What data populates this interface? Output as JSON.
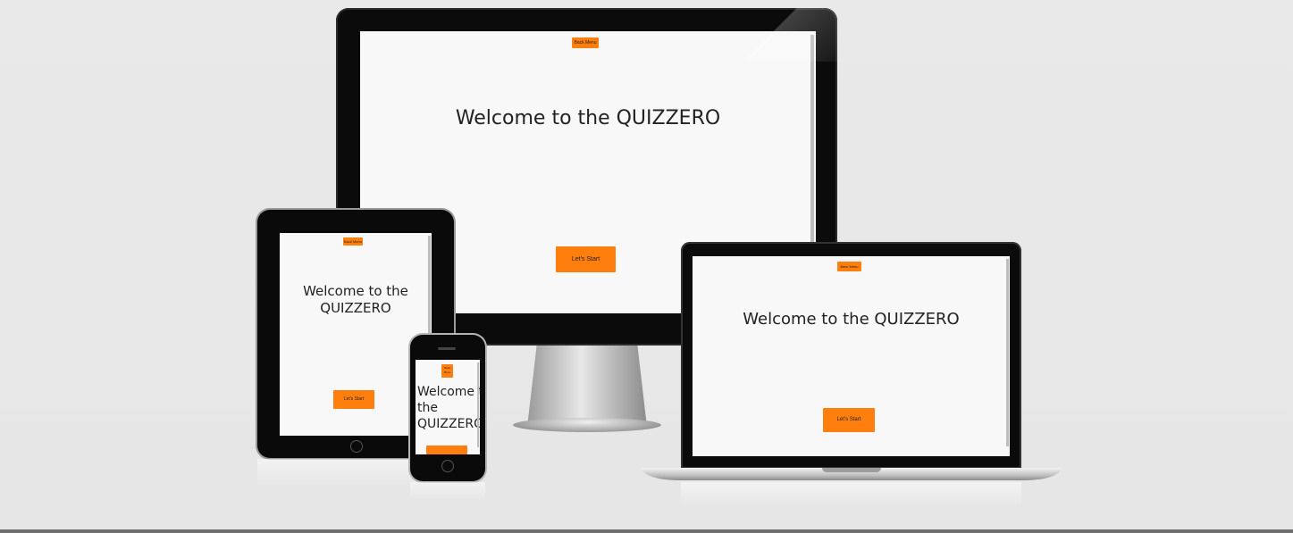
{
  "page": {
    "nav_button_label": "Back Menu",
    "title": "Welcome to the QUIZZERO",
    "start_button_label": "Let's Start"
  },
  "devices": [
    "desktop-monitor",
    "tablet",
    "laptop",
    "phone"
  ],
  "colors": {
    "accent": "#ff7f0e",
    "screen_background": "#f8f8f8",
    "device_frame": "#0b0b0b",
    "backdrop": "#e8e8e8"
  }
}
